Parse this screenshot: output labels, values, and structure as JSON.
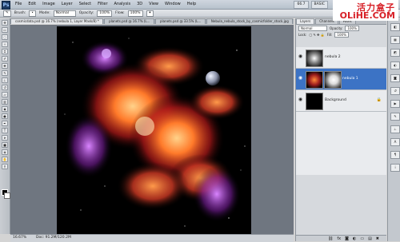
{
  "menubar": {
    "logo": "Ps",
    "items": [
      "File",
      "Edit",
      "Image",
      "Layer",
      "Select",
      "Filter",
      "Analysis",
      "3D",
      "View",
      "Window",
      "Help"
    ],
    "right_buttons": [
      "66.7",
      "BASIC"
    ]
  },
  "watermark": {
    "cn": "活力盒子",
    "en": "OLiHE.COM"
  },
  "options": {
    "brush_label": "Brush:",
    "mode_label": "Mode:",
    "mode_value": "Normal",
    "opacity_label": "Opacity:",
    "opacity_value": "100%",
    "flow_label": "Flow:",
    "flow_value": "100%"
  },
  "doc_tabs": [
    {
      "label": "cosmicdata.psd @ 16.7% (nebula 1, Layer Mask/8) *",
      "active": true
    },
    {
      "label": "planets.psd @ 16.7% (L...",
      "active": false
    },
    {
      "label": "planets.psd @ 33.5% (L...",
      "active": false
    },
    {
      "label": "Nebula_nebula_stock_by_cosmicfolder_stock.jpg",
      "active": false
    }
  ],
  "status": {
    "zoom": "16.67%",
    "doc": "Doc: 91.2M/120.2M"
  },
  "panel": {
    "tabs": [
      "Layers",
      "Channels",
      "Paths"
    ],
    "blend_mode": "Normal",
    "opacity_label": "Opacity:",
    "opacity_value": "100%",
    "lock_label": "Lock:",
    "fill_label": "Fill:",
    "fill_value": "100%",
    "layers": [
      {
        "name": "nebula 2",
        "selected": false
      },
      {
        "name": "nebula 1",
        "selected": true
      },
      {
        "name": "Background",
        "selected": false
      }
    ]
  },
  "colors": {
    "selection": "#3c73c5",
    "canvas": "#000000"
  }
}
